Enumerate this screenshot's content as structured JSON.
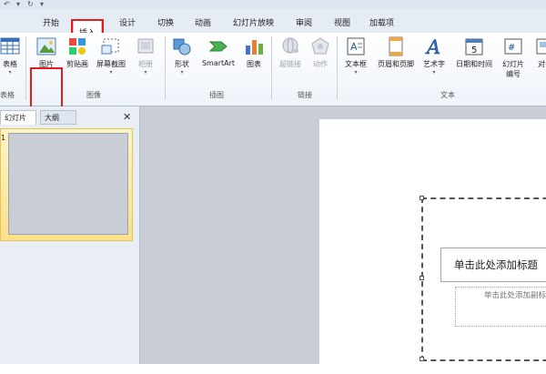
{
  "tabs": [
    {
      "label": "开始"
    },
    {
      "label": "插入"
    },
    {
      "label": "设计"
    },
    {
      "label": "切换"
    },
    {
      "label": "动画"
    },
    {
      "label": "幻灯片放映"
    },
    {
      "label": "审阅"
    },
    {
      "label": "视图"
    },
    {
      "label": "加载项"
    }
  ],
  "ribbon": {
    "table": {
      "label": "表格",
      "group": "表格"
    },
    "picture": {
      "label": "图片"
    },
    "clipart": {
      "label": "剪贴画"
    },
    "screenshot": {
      "label": "屏幕截图"
    },
    "album": {
      "label": "相册"
    },
    "image_group": "图像",
    "shapes": {
      "label": "形状"
    },
    "smartart": {
      "label": "SmartArt"
    },
    "chart": {
      "label": "图表"
    },
    "illustration_group": "插图",
    "hyperlink": {
      "label": "超链接"
    },
    "action": {
      "label": "动作"
    },
    "link_group": "链接",
    "textbox": {
      "label": "文本框"
    },
    "header_footer": {
      "label": "页眉和页脚"
    },
    "wordart": {
      "label": "艺术字"
    },
    "datetime": {
      "label": "日期和时间"
    },
    "slide_number": {
      "label": "幻灯片\n编号"
    },
    "object": {
      "label": "对象"
    },
    "text_group": "文本"
  },
  "panel": {
    "slides_tab": "幻灯片",
    "outline_tab": "大纲",
    "close": "✕",
    "thumb_number": "1"
  },
  "slide": {
    "title_placeholder": "单击此处添加标题",
    "subtitle_placeholder": "单击此处添加副标题"
  },
  "colors": {
    "highlight": "#e41c1c",
    "ribbon_bg": "#eef3f9",
    "canvas_bg": "#c9ced6",
    "thumb_selected": "#ffe08a"
  }
}
